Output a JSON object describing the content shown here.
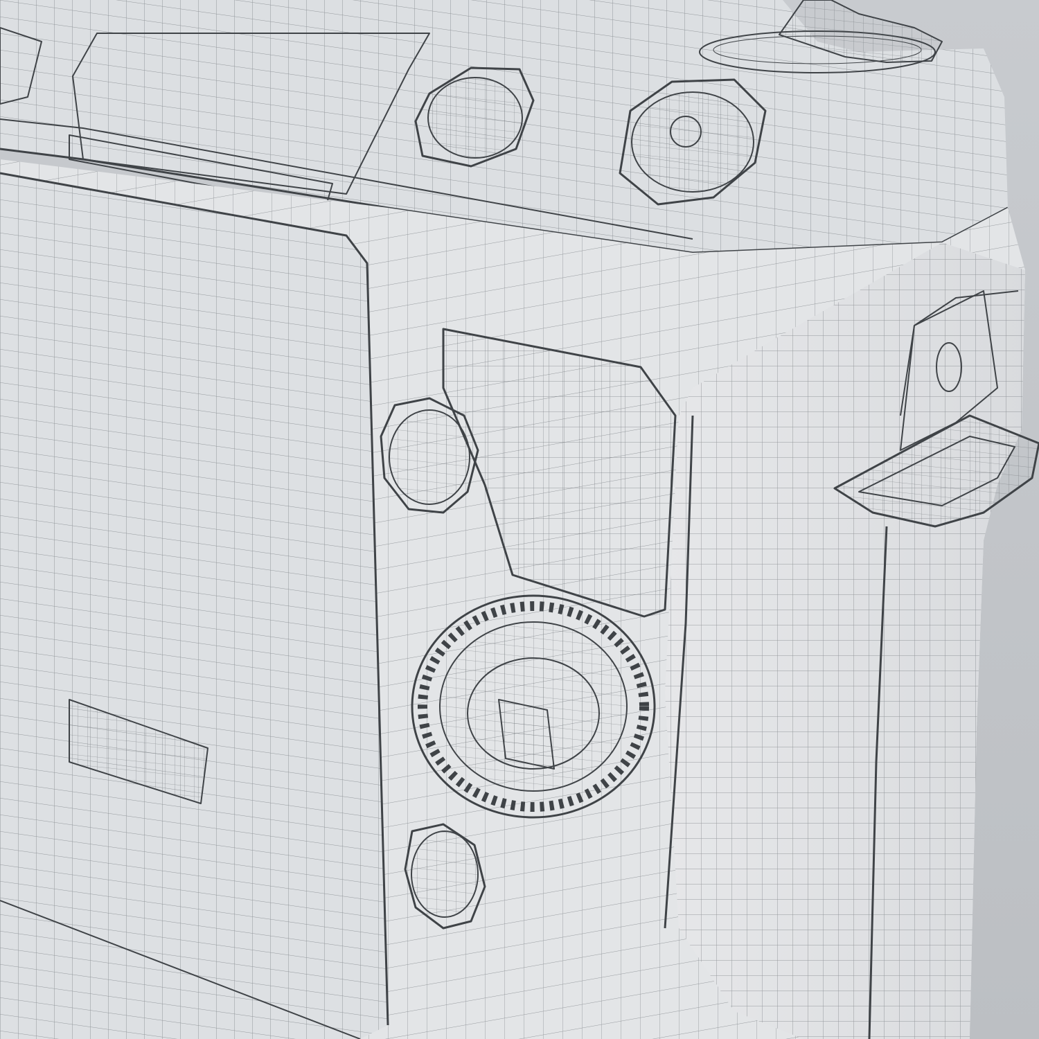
{
  "scene": {
    "subject": "camera-body-wireframe",
    "colors": {
      "background": "#c9ccd0",
      "floor": "#c3c6ca",
      "body": "#e4e6e8",
      "body_shadow": "#cfd2d6",
      "screen": "#dfe2e5",
      "wire": "#555a60",
      "edge": "#3f4347"
    }
  }
}
